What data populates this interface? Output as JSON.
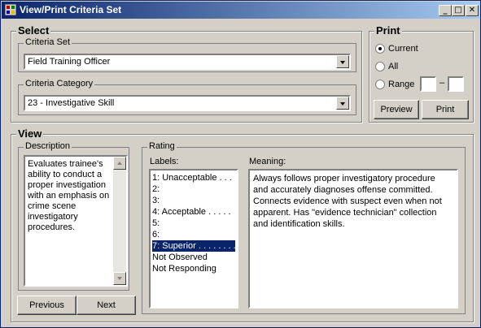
{
  "window": {
    "title": "View/Print Criteria Set",
    "controls": {
      "minimize": "_",
      "maximize": "□",
      "close": "✕"
    }
  },
  "select": {
    "title": "Select",
    "criteria_set": {
      "label": "Criteria Set",
      "value": "Field Training Officer"
    },
    "criteria_category": {
      "label": "Criteria Category",
      "value": "23 - Investigative Skill"
    }
  },
  "print": {
    "title": "Print",
    "options": [
      {
        "label": "Current",
        "selected": true
      },
      {
        "label": "All",
        "selected": false
      },
      {
        "label": "Range",
        "selected": false
      }
    ],
    "range_separator": "–",
    "range_from": "",
    "range_to": "",
    "preview_label": "Preview",
    "print_label": "Print"
  },
  "view": {
    "title": "View",
    "description": {
      "label": "Description",
      "text": "Evaluates trainee's ability to conduct a proper investigation with an emphasis on crime scene investigatory procedures."
    },
    "previous_label": "Previous",
    "next_label": "Next",
    "rating": {
      "label": "Rating",
      "labels_header": "Labels:",
      "meaning_header": "Meaning:",
      "labels": [
        "1: Unacceptable . . .",
        "2:",
        "3:",
        "4: Acceptable . . . . .",
        "5:",
        "6:",
        "7: Superior . . . . . . . .",
        "Not Observed",
        "Not Responding"
      ],
      "selected_index": 6,
      "meaning": "Always follows proper investigatory procedure and accurately diagnoses offense committed. Connects evidence with suspect even when not apparent.  Has \"evidence technician\" collection and identification skills."
    }
  },
  "colors": {
    "titlebar_start": "#0a246a",
    "titlebar_end": "#a6caf0",
    "selection": "#0a246a",
    "face": "#d4d0c8"
  }
}
